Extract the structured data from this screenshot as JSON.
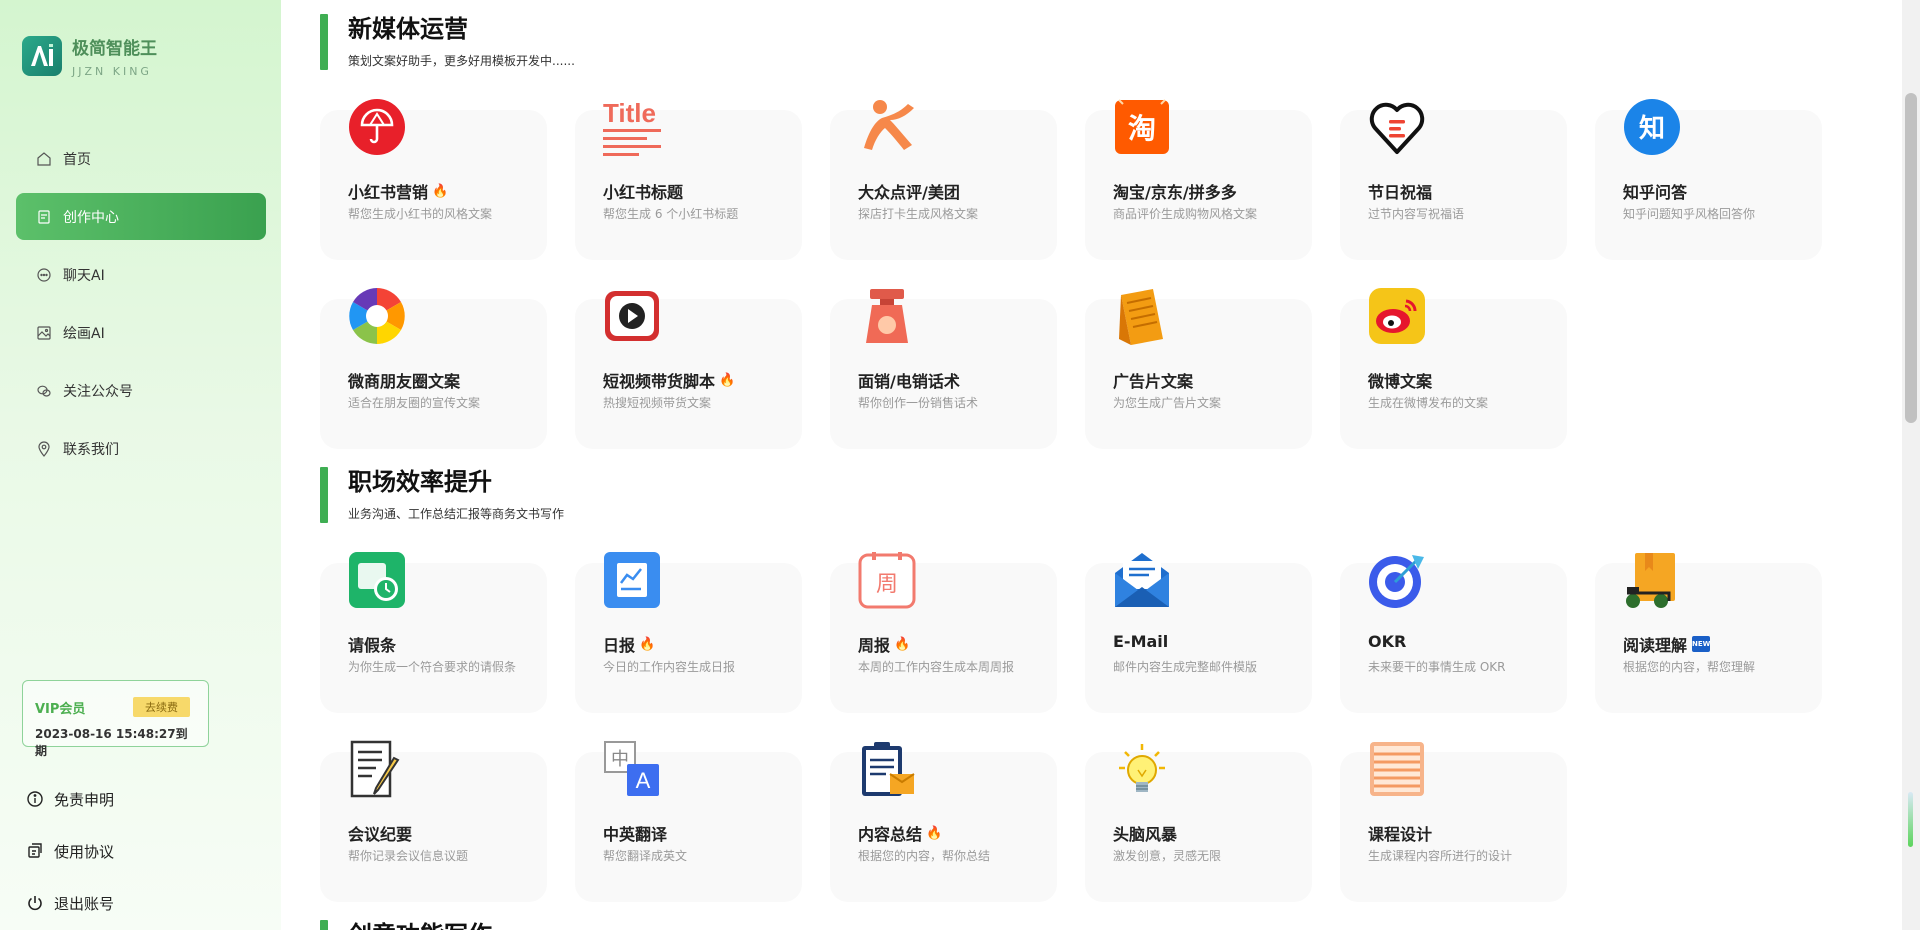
{
  "app": {
    "title": "极简智能王",
    "subtitle": "JJZN KING"
  },
  "nav": [
    {
      "label": "首页",
      "icon": "home-icon"
    },
    {
      "label": "创作中心",
      "icon": "doc-icon",
      "active": true
    },
    {
      "label": "聊天AI",
      "icon": "chat-icon"
    },
    {
      "label": "绘画AI",
      "icon": "image-icon"
    },
    {
      "label": "关注公众号",
      "icon": "wechat-icon"
    },
    {
      "label": "联系我们",
      "icon": "location-icon"
    }
  ],
  "vip": {
    "label": "VIP会员",
    "renew": "去续费",
    "expire": "2023-08-16 15:48:27到期"
  },
  "bottom": [
    {
      "label": "免责申明",
      "icon": "info-icon"
    },
    {
      "label": "使用协议",
      "icon": "agreement-icon"
    },
    {
      "label": "退出账号",
      "icon": "power-icon"
    }
  ],
  "sections": [
    {
      "title": "新媒体运营",
      "subtitle": "策划文案好助手，更多好用模板开发中......"
    },
    {
      "title": "职场效率提升",
      "subtitle": "业务沟通、工作总结汇报等商务文书写作"
    },
    {
      "title": "创意功能写作",
      "subtitle": ""
    }
  ],
  "cards": [
    {
      "title": "小红书营销",
      "desc": "帮您生成小红书的风格文案",
      "hot": "🔥",
      "icon": "xiaohongshu-icon"
    },
    {
      "title": "小红书标题",
      "desc": "帮您生成 6 个小红书标题",
      "icon": "title-icon",
      "icon_text": "Title"
    },
    {
      "title": "大众点评/美团",
      "desc": "探店打卡生成风格文案",
      "icon": "dianping-icon"
    },
    {
      "title": "淘宝/京东/拼多多",
      "desc": "商品评价生成购物风格文案",
      "icon": "taobao-icon",
      "icon_text": "淘"
    },
    {
      "title": "节日祝福",
      "desc": "过节内容写祝福语",
      "icon": "heart-icon"
    },
    {
      "title": "知乎问答",
      "desc": "知乎问题知乎风格回答你",
      "icon": "zhihu-icon",
      "icon_text": "知"
    },
    {
      "title": "微商朋友圈文案",
      "desc": "适合在朋友圈的宣传文案",
      "icon": "moments-icon"
    },
    {
      "title": "短视频带货脚本",
      "desc": "热搜短视频带货文案",
      "hot": "🔥",
      "icon": "video-icon"
    },
    {
      "title": "面销/电销话术",
      "desc": "帮你创作一份销售话术",
      "icon": "scale-icon"
    },
    {
      "title": "广告片文案",
      "desc": "为您生成广告片文案",
      "icon": "ad-icon"
    },
    {
      "title": "微博文案",
      "desc": "生成在微博发布的文案",
      "icon": "weibo-icon"
    },
    {
      "title": "请假条",
      "desc": "为你生成一个符合要求的请假条",
      "icon": "leave-calendar-icon"
    },
    {
      "title": "日报",
      "desc": "今日的工作内容生成日报",
      "hot": "🔥",
      "icon": "daily-report-icon"
    },
    {
      "title": "周报",
      "desc": "本周的工作内容生成本周周报",
      "hot": "🔥",
      "icon": "weekly-report-icon",
      "icon_text": "周"
    },
    {
      "title": "E-Mail",
      "desc": "邮件内容生成完整邮件模版",
      "icon": "email-icon"
    },
    {
      "title": "OKR",
      "desc": "未来要干的事情生成 OKR",
      "icon": "target-icon"
    },
    {
      "title": "阅读理解",
      "desc": "根据您的内容，帮您理解",
      "new": "NEW",
      "icon": "reading-icon"
    },
    {
      "title": "会议纪要",
      "desc": "帮你记录会议信息议题",
      "icon": "meeting-notes-icon"
    },
    {
      "title": "中英翻译",
      "desc": "帮您翻译成英文",
      "icon": "translate-icon",
      "icon_text": "中",
      "icon_text2": "A"
    },
    {
      "title": "内容总结",
      "desc": "根据您的内容，帮你总结",
      "hot": "🔥",
      "icon": "summary-icon"
    },
    {
      "title": "头脑风暴",
      "desc": "激发创意，灵感无限",
      "icon": "bulb-icon"
    },
    {
      "title": "课程设计",
      "desc": "生成课程内容所进行的设计",
      "icon": "course-icon"
    }
  ]
}
